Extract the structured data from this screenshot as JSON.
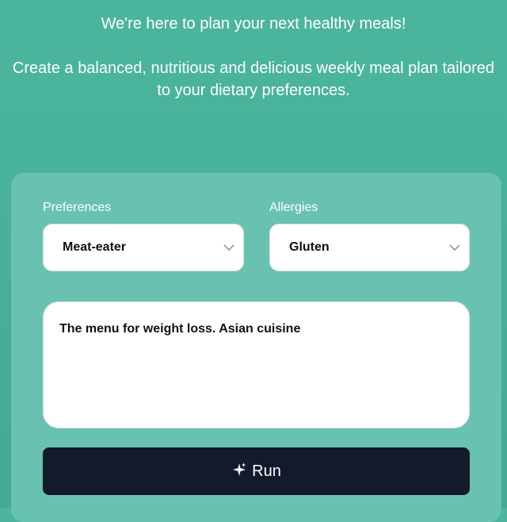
{
  "hero": {
    "title": "We're here to plan your next healthy meals!",
    "subtitle": "Create a balanced, nutritious and delicious weekly meal plan tailored to your dietary preferences."
  },
  "form": {
    "preferences": {
      "label": "Preferences",
      "selected": "Meat-eater",
      "icon": "chevron-down-icon"
    },
    "allergies": {
      "label": "Allergies",
      "selected": "Gluten",
      "icon": "chevron-down-icon"
    },
    "prompt": {
      "value": "The menu for weight loss. Asian cuisine"
    },
    "run_button": {
      "label": "Run",
      "icon": "sparkle-icon"
    }
  },
  "colors": {
    "background": "#46af98",
    "card": "#69c2b1",
    "button": "#121a2b",
    "text_light": "#ffffff",
    "text_dark": "#111111"
  }
}
